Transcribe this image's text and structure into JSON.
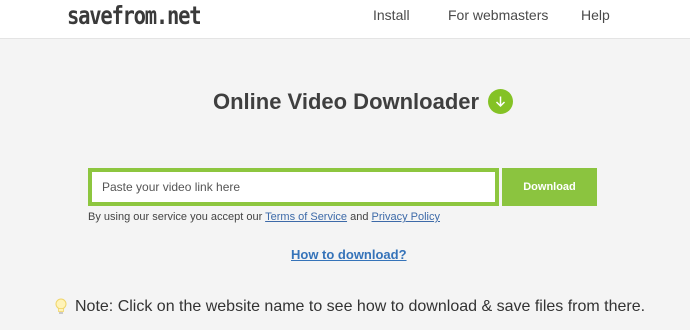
{
  "header": {
    "logo": "savefrom.net",
    "nav": [
      "Install",
      "For webmasters",
      "Help"
    ]
  },
  "main": {
    "title": "Online Video Downloader",
    "title_icon": "arrow-down-circle-icon",
    "input_placeholder": "Paste your video link here",
    "input_value": "",
    "download_label": "Download",
    "terms_prefix": "By using our service you accept our",
    "terms_link": "Terms of Service",
    "terms_and": "and",
    "privacy_link": "Privacy Policy",
    "howto_link": "How to download?",
    "note_icon": "lightbulb-icon",
    "note_text": "Note: Click on the website name to see how to download & save files from there."
  },
  "colors": {
    "accent_green": "#8bc43f",
    "link_blue": "#3573b9"
  }
}
